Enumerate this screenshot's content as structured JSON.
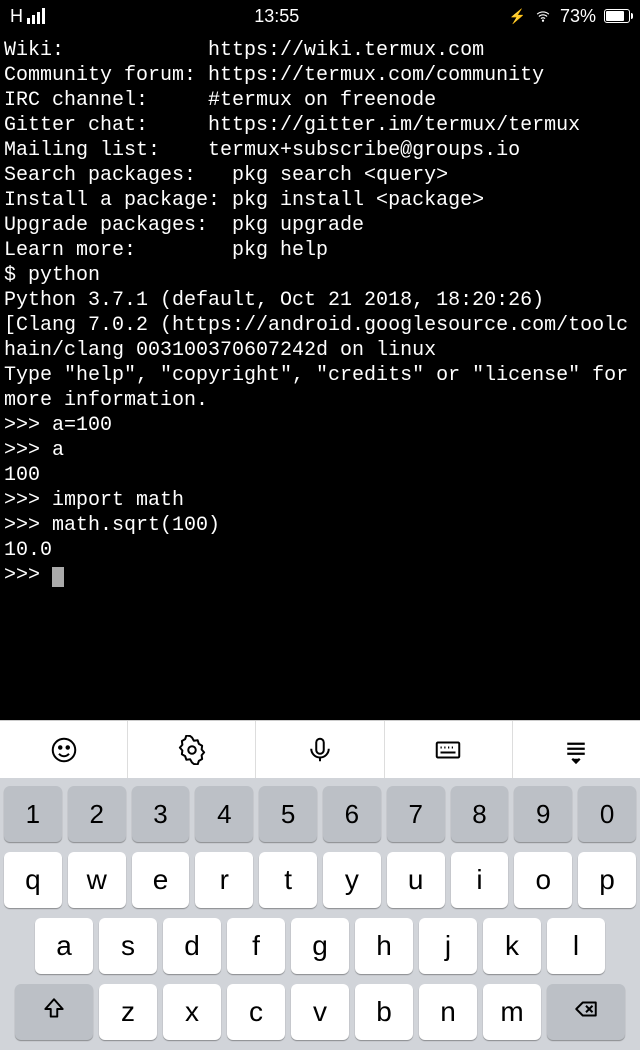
{
  "status": {
    "carrier": "H",
    "time": "13:55",
    "battery_pct": "73%"
  },
  "terminal": {
    "lines": [
      "Wiki:            https://wiki.termux.com",
      "Community forum: https://termux.com/community",
      "IRC channel:     #termux on freenode",
      "Gitter chat:     https://gitter.im/termux/termux",
      "Mailing list:    termux+subscribe@groups.io",
      "",
      "Search packages:   pkg search <query>",
      "Install a package: pkg install <package>",
      "Upgrade packages:  pkg upgrade",
      "Learn more:        pkg help",
      "$ python",
      "Python 3.7.1 (default, Oct 21 2018, 18:20:26)",
      "[Clang 7.0.2 (https://android.googlesource.com/toolchain/clang 003100370607242d on linux",
      "Type \"help\", \"copyright\", \"credits\" or \"license\" for more information.",
      ">>> a=100",
      ">>> a",
      "100",
      ">>> import math",
      ">>> math.sqrt(100)",
      "10.0"
    ],
    "prompt": ">>> "
  },
  "toolbar": {
    "icons": [
      "emoji-icon",
      "gear-icon",
      "mic-icon",
      "keyboard-icon",
      "collapse-icon"
    ]
  },
  "keyboard": {
    "row_nums": [
      "1",
      "2",
      "3",
      "4",
      "5",
      "6",
      "7",
      "8",
      "9",
      "0"
    ],
    "row_top": [
      "q",
      "w",
      "e",
      "r",
      "t",
      "y",
      "u",
      "i",
      "o",
      "p"
    ],
    "row_mid": [
      "a",
      "s",
      "d",
      "f",
      "g",
      "h",
      "j",
      "k",
      "l"
    ],
    "row_bot": [
      "z",
      "x",
      "c",
      "v",
      "b",
      "n",
      "m"
    ]
  }
}
